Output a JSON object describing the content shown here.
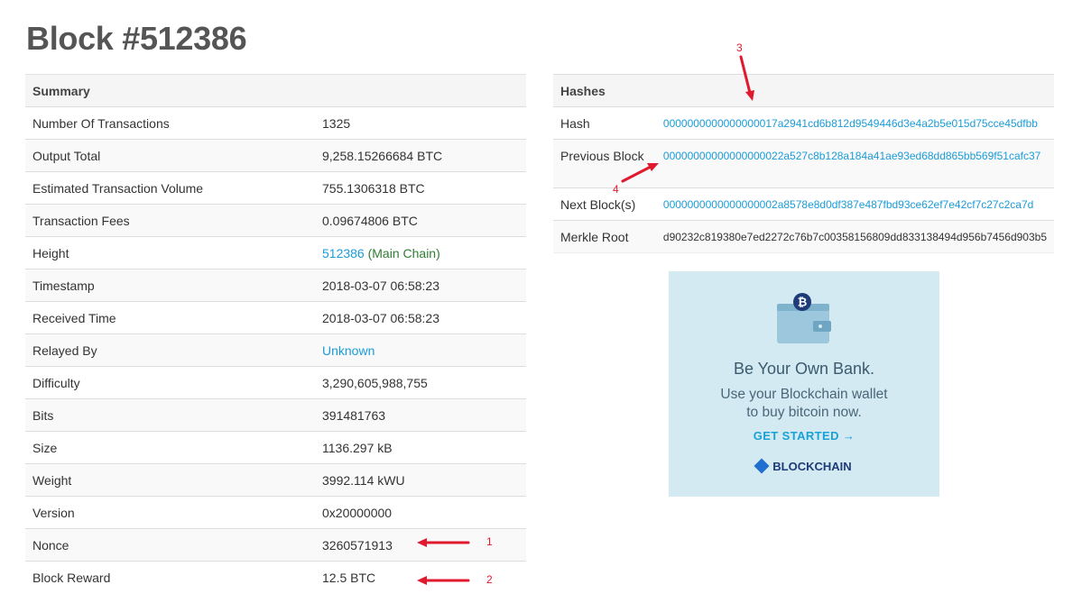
{
  "page": {
    "title": "Block #512386"
  },
  "summary": {
    "header": "Summary",
    "rows": [
      {
        "key": "Number Of Transactions",
        "value": "1325"
      },
      {
        "key": "Output Total",
        "value": "9,258.15266684 BTC"
      },
      {
        "key": "Estimated Transaction Volume",
        "value": "755.1306318 BTC"
      },
      {
        "key": "Transaction Fees",
        "value": "0.09674806 BTC"
      },
      {
        "key": "Height",
        "value": "512386",
        "suffix": "(Main Chain)"
      },
      {
        "key": "Timestamp",
        "value": "2018-03-07 06:58:23"
      },
      {
        "key": "Received Time",
        "value": "2018-03-07 06:58:23"
      },
      {
        "key": "Relayed By",
        "value": "Unknown"
      },
      {
        "key": "Difficulty",
        "value": "3,290,605,988,755"
      },
      {
        "key": "Bits",
        "value": "391481763"
      },
      {
        "key": "Size",
        "value": "1136.297 kB"
      },
      {
        "key": "Weight",
        "value": "3992.114 kWU"
      },
      {
        "key": "Version",
        "value": "0x20000000"
      },
      {
        "key": "Nonce",
        "value": "3260571913"
      },
      {
        "key": "Block Reward",
        "value": "12.5 BTC"
      }
    ]
  },
  "hashes": {
    "header": "Hashes",
    "rows": [
      {
        "key": "Hash",
        "value": "0000000000000000017a2941cd6b812d9549446d3e4a2b5e015d75cce45dfbb"
      },
      {
        "key": "Previous Block",
        "value": "00000000000000000022a527c8b128a184a41ae93ed68dd865bb569f51cafc37"
      },
      {
        "key": "Next Block(s)",
        "value": "0000000000000000002a8578e8d0df387e487fbd93ce62ef7e42cf7c27c2ca7d"
      },
      {
        "key": "Merkle Root",
        "value": "d90232c819380e7ed2272c76b7c00358156809dd833138494d956b7456d903b5"
      }
    ]
  },
  "ad": {
    "headline": "Be Your Own Bank.",
    "line1": "Use your Blockchain wallet",
    "line2": "to buy bitcoin now.",
    "cta": "GET STARTED →",
    "brand": "BLOCKCHAIN",
    "icon": "bitcoin-wallet-icon"
  },
  "annotations": {
    "a1": "1",
    "a2": "2",
    "a3": "3",
    "a4": "4",
    "color": "#e0192f"
  }
}
